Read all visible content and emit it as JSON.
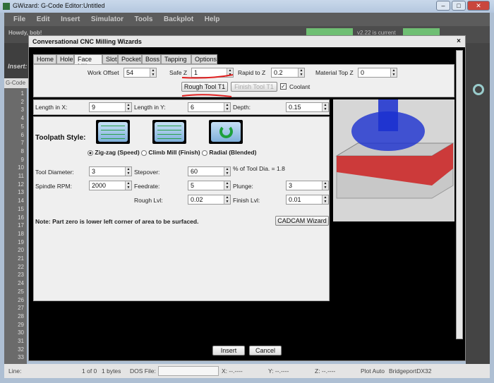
{
  "window": {
    "title": "GWizard: G-Code Editor:Untitled",
    "controls": [
      "–",
      "□",
      "✕"
    ]
  },
  "menu": [
    "File",
    "Edit",
    "Insert",
    "Simulator",
    "Tools",
    "Backplot",
    "Help"
  ],
  "toolbar": {
    "greeting": "Howdy, bob!",
    "version": "v2.22 is current",
    "insert_label": "Insert:",
    "gcode_label": "G-Code"
  },
  "gutter": {
    "lines": [
      "1",
      "2",
      "3",
      "4",
      "5",
      "6",
      "7",
      "8",
      "9",
      "10",
      "11",
      "12",
      "13",
      "14",
      "15",
      "16",
      "17",
      "18",
      "19",
      "20",
      "21",
      "22",
      "23",
      "24",
      "25",
      "26",
      "27",
      "28",
      "29",
      "30",
      "31",
      "32",
      "33"
    ]
  },
  "dialog": {
    "title": "Conversational CNC Milling Wizards",
    "close": "×",
    "tabs": [
      "Home",
      "Hole",
      "Face Mill",
      "Slot",
      "Pocket",
      "Boss",
      "Tapping",
      "Options"
    ],
    "active_tab": "Face Mill",
    "top": {
      "work_offset_label": "Work Offset",
      "work_offset": "54",
      "safe_z_label": "Safe Z",
      "safe_z": "1",
      "rapid_label": "Rapid to Z",
      "rapid": "0.2",
      "material_label": "Material Top Z",
      "material": "0",
      "rough_tool": "Rough Tool T1",
      "finish_tool": "Finish Tool T1",
      "coolant_label": "Coolant",
      "coolant_checked": true
    },
    "dims": {
      "len_x_label": "Length in X:",
      "len_x": "9",
      "len_y_label": "Length in Y:",
      "len_y": "6",
      "depth_label": "Depth:",
      "depth": "0.15"
    },
    "toolpath": {
      "label": "Toolpath Style:",
      "options": [
        "Zig-zag (Speed)",
        "Climb Mill (Finish)",
        "Radial (Blended)"
      ],
      "selected": "Zig-zag (Speed)"
    },
    "params": {
      "tool_dia_label": "Tool Diameter:",
      "tool_dia": "3",
      "stepover_label": "Stepover:",
      "stepover": "60",
      "stepover_note": "% of Tool Dia. = 1.8",
      "rpm_label": "Spindle RPM:",
      "rpm": "2000",
      "feed_label": "Feedrate:",
      "feed": "5",
      "plunge_label": "Plunge:",
      "plunge": "3",
      "rough_label": "Rough Lvl:",
      "rough": "0.02",
      "finish_label": "Finish Lvl:",
      "finish": "0.01"
    },
    "note": "Note:  Part zero is lower left corner of area to be surfaced.",
    "cadcam": "CADCAM Wizard",
    "insert": "Insert",
    "cancel": "Cancel",
    "colors": {
      "annotation": "#e02020",
      "tool": "#1a2fd0",
      "stock_top": "#cc2a2a"
    }
  },
  "status": {
    "line": "Line:",
    "count": "1 of 0",
    "bytes": "1 bytes",
    "dos_label": "DOS File:",
    "x": "X:  --.----",
    "y": "Y:  --.----",
    "z": "Z:  --.----",
    "plot": "Plot Auto",
    "machine": "BridgeportDX32"
  }
}
